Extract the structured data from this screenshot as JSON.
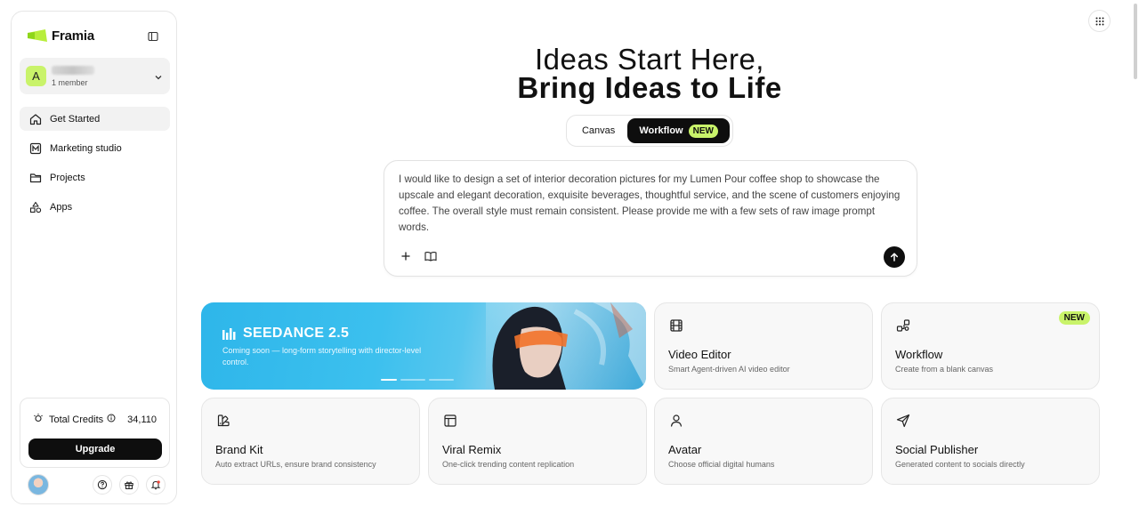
{
  "brand": {
    "name": "Framia",
    "accent": "#c9f36a"
  },
  "workspace": {
    "initial": "A",
    "members": "1 member"
  },
  "sidebar": {
    "items": [
      {
        "label": "Get Started",
        "icon": "home-icon"
      },
      {
        "label": "Marketing studio",
        "icon": "marketing-icon"
      },
      {
        "label": "Projects",
        "icon": "folder-icon"
      },
      {
        "label": "Apps",
        "icon": "apps-icon"
      }
    ]
  },
  "credits": {
    "label": "Total Credits",
    "value": "34,110",
    "upgrade_label": "Upgrade"
  },
  "hero": {
    "line1": "Ideas Start Here,",
    "line2": "Bring Ideas to Life"
  },
  "mode_toggle": {
    "canvas_label": "Canvas",
    "workflow_label": "Workflow",
    "new_badge": "NEW"
  },
  "prompt": {
    "text": "I would like to design a set of interior decoration pictures for my Lumen Pour coffee shop to showcase the upscale and elegant decoration, exquisite beverages, thoughtful service, and the scene of customers enjoying coffee. The overall style must remain consistent. Please provide me with a few sets of raw image prompt words."
  },
  "banner": {
    "title": "SEEDANCE 2.5",
    "description": "Coming soon — long-form storytelling with director-level control."
  },
  "cards": [
    {
      "title": "Video Editor",
      "subtitle": "Smart Agent-driven AI video editor",
      "icon": "film-icon"
    },
    {
      "title": "Workflow",
      "subtitle": "Create from a blank canvas",
      "icon": "workflow-icon",
      "badge": "NEW"
    },
    {
      "title": "Brand Kit",
      "subtitle": "Auto extract URLs, ensure brand consistency",
      "icon": "brand-kit-icon"
    },
    {
      "title": "Viral Remix",
      "subtitle": "One-click trending content replication",
      "icon": "layout-icon"
    },
    {
      "title": "Avatar",
      "subtitle": "Choose official digital humans",
      "icon": "user-icon"
    },
    {
      "title": "Social Publisher",
      "subtitle": "Generated content to socials directly",
      "icon": "send-icon"
    }
  ]
}
